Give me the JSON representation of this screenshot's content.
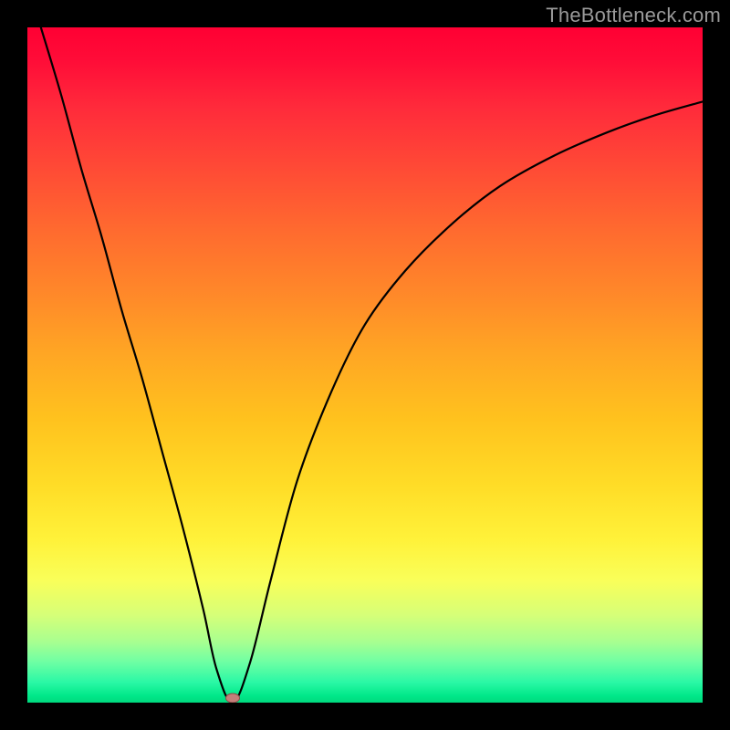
{
  "watermark": "TheBottleneck.com",
  "marker": {
    "x_pct": 30.4,
    "y_pct": 99.3
  },
  "chart_data": {
    "type": "line",
    "title": "",
    "xlabel": "",
    "ylabel": "",
    "xlim": [
      0,
      100
    ],
    "ylim": [
      0,
      100
    ],
    "grid": false,
    "legend": false,
    "annotations": [],
    "series": [
      {
        "name": "bottleneck-curve",
        "x": [
          2,
          5,
          8,
          11,
          14,
          17,
          20,
          23,
          26,
          28,
          30.4,
          33,
          36,
          40,
          45,
          50,
          56,
          63,
          70,
          78,
          86,
          93,
          100
        ],
        "y": [
          100,
          90,
          79,
          69,
          58,
          48,
          37,
          26,
          14,
          5,
          0,
          6,
          18,
          33,
          46,
          56,
          64,
          71,
          76.5,
          81,
          84.5,
          87,
          89
        ]
      }
    ],
    "background_gradient": {
      "direction": "vertical",
      "stops": [
        {
          "pos": 0.0,
          "color": "#ff0033"
        },
        {
          "pos": 0.3,
          "color": "#ff6a2f"
        },
        {
          "pos": 0.58,
          "color": "#ffc21e"
        },
        {
          "pos": 0.82,
          "color": "#f9ff5a"
        },
        {
          "pos": 0.94,
          "color": "#6effa4"
        },
        {
          "pos": 1.0,
          "color": "#00d97e"
        }
      ]
    },
    "marker": {
      "x": 30.4,
      "y": 0,
      "color": "#c47e7a"
    }
  }
}
